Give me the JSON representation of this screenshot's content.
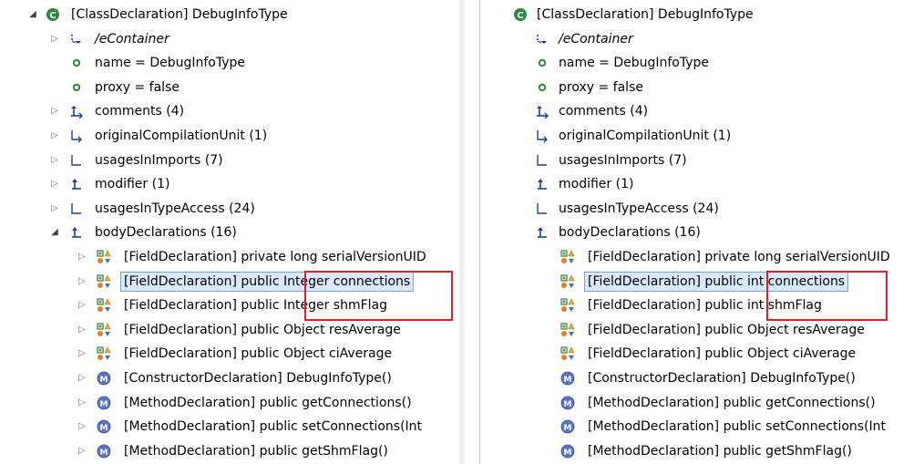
{
  "panels": [
    {
      "id": "left",
      "rows": [
        {
          "twisty": "expanded",
          "icon": "class-icon",
          "label": "[ClassDeclaration] DebugInfoType"
        },
        {
          "twisty": "collapsed",
          "icon": "container-icon",
          "label": "/eContainer",
          "italic": true
        },
        {
          "twisty": "none",
          "icon": "attribute-icon",
          "label": "name = DebugInfoType"
        },
        {
          "twisty": "none",
          "icon": "attribute-icon",
          "label": "proxy = false"
        },
        {
          "twisty": "collapsed",
          "icon": "containment-many-icon",
          "label": "comments (4)"
        },
        {
          "twisty": "collapsed",
          "icon": "reference-many-icon",
          "label": "originalCompilationUnit (1)"
        },
        {
          "twisty": "collapsed",
          "icon": "reference-icon",
          "label": "usagesInImports (7)"
        },
        {
          "twisty": "collapsed",
          "icon": "containment-icon",
          "label": "modifier (1)"
        },
        {
          "twisty": "collapsed",
          "icon": "reference-icon",
          "label": "usagesInTypeAccess (24)"
        },
        {
          "twisty": "expanded",
          "icon": "containment-icon",
          "label": "bodyDeclarations (16)"
        },
        {
          "twisty": "collapsed",
          "icon": "field-icon",
          "label": "[FieldDeclaration] private long serialVersionUID"
        },
        {
          "twisty": "collapsed",
          "icon": "field-icon",
          "label": "[FieldDeclaration] public Integer connections",
          "selected": true
        },
        {
          "twisty": "collapsed",
          "icon": "field-icon",
          "label": "[FieldDeclaration] public Integer shmFlag"
        },
        {
          "twisty": "collapsed",
          "icon": "field-icon",
          "label": "[FieldDeclaration] public Object resAverage"
        },
        {
          "twisty": "collapsed",
          "icon": "field-icon",
          "label": "[FieldDeclaration] public Object ciAverage"
        },
        {
          "twisty": "collapsed",
          "icon": "method-icon",
          "label": "[ConstructorDeclaration] DebugInfoType()"
        },
        {
          "twisty": "collapsed",
          "icon": "method-icon",
          "label": "[MethodDeclaration] public getConnections()"
        },
        {
          "twisty": "collapsed",
          "icon": "method-icon",
          "label": "[MethodDeclaration] public setConnections(Int"
        },
        {
          "twisty": "collapsed",
          "icon": "method-icon",
          "label": "[MethodDeclaration] public getShmFlag()"
        }
      ]
    },
    {
      "id": "right",
      "rows": [
        {
          "twisty": "none",
          "icon": "class-icon",
          "label": "[ClassDeclaration] DebugInfoType"
        },
        {
          "twisty": "none",
          "icon": "container-icon",
          "label": "/eContainer",
          "italic": true
        },
        {
          "twisty": "none",
          "icon": "attribute-icon",
          "label": "name = DebugInfoType"
        },
        {
          "twisty": "none",
          "icon": "attribute-icon",
          "label": "proxy = false"
        },
        {
          "twisty": "none",
          "icon": "containment-many-icon",
          "label": "comments (4)"
        },
        {
          "twisty": "none",
          "icon": "reference-many-icon",
          "label": "originalCompilationUnit (1)"
        },
        {
          "twisty": "none",
          "icon": "reference-icon",
          "label": "usagesInImports (7)"
        },
        {
          "twisty": "none",
          "icon": "containment-icon",
          "label": "modifier (1)"
        },
        {
          "twisty": "none",
          "icon": "reference-icon",
          "label": "usagesInTypeAccess (24)"
        },
        {
          "twisty": "none",
          "icon": "containment-icon",
          "label": "bodyDeclarations (16)"
        },
        {
          "twisty": "none",
          "icon": "field-icon",
          "label": "[FieldDeclaration] private long serialVersionUID"
        },
        {
          "twisty": "none",
          "icon": "field-icon",
          "label": "[FieldDeclaration] public int connections",
          "selected": true
        },
        {
          "twisty": "none",
          "icon": "field-icon",
          "label": "[FieldDeclaration] public int shmFlag"
        },
        {
          "twisty": "none",
          "icon": "field-icon",
          "label": "[FieldDeclaration] public Object resAverage"
        },
        {
          "twisty": "none",
          "icon": "field-icon",
          "label": "[FieldDeclaration] public Object ciAverage"
        },
        {
          "twisty": "none",
          "icon": "method-icon",
          "label": "[ConstructorDeclaration] DebugInfoType()"
        },
        {
          "twisty": "none",
          "icon": "method-icon",
          "label": "[MethodDeclaration] public getConnections()"
        },
        {
          "twisty": "none",
          "icon": "method-icon",
          "label": "[MethodDeclaration] public setConnections(Int"
        },
        {
          "twisty": "none",
          "icon": "method-icon",
          "label": "[MethodDeclaration] public getShmFlag()"
        }
      ]
    }
  ],
  "colors": {
    "highlight_box": "#e41e26",
    "selection_bg": "#d9e8fb",
    "class_icon": "#2e8b3a",
    "method_icon": "#5a72c8",
    "reference_icon": "#1b3f9a"
  }
}
